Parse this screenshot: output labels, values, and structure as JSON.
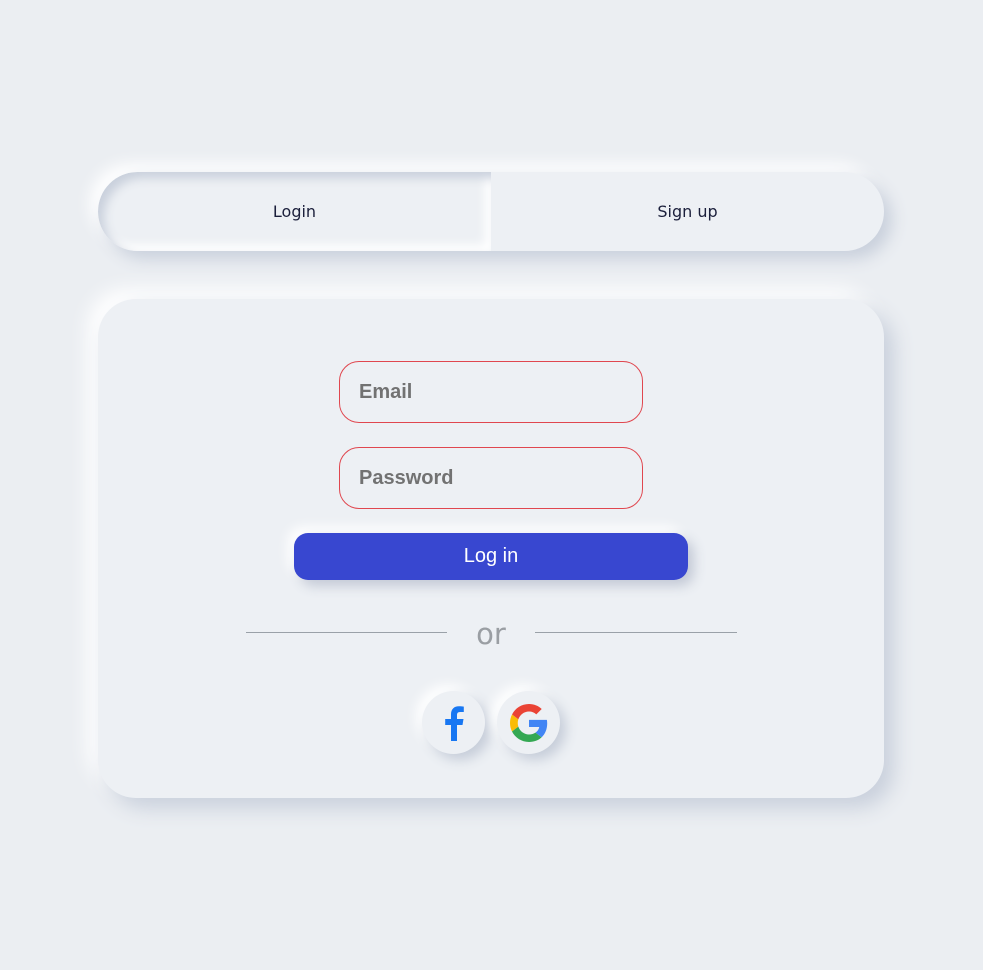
{
  "tabs": [
    {
      "label": "Login",
      "active": true
    },
    {
      "label": "Sign up",
      "active": false
    }
  ],
  "form": {
    "email_placeholder": "Email",
    "email_value": "",
    "password_placeholder": "Password",
    "password_value": "",
    "submit_label": "Log in"
  },
  "divider": {
    "label": "or"
  },
  "social": [
    {
      "icon": "facebook-icon",
      "color": "#1877f2"
    },
    {
      "icon": "google-icon",
      "colors": [
        "#4285f4",
        "#ea4335",
        "#fbbc05",
        "#34a853"
      ]
    }
  ],
  "colors": {
    "background": "#ebeef2",
    "accent": "#3847d0",
    "field_border": "#e0474f"
  }
}
